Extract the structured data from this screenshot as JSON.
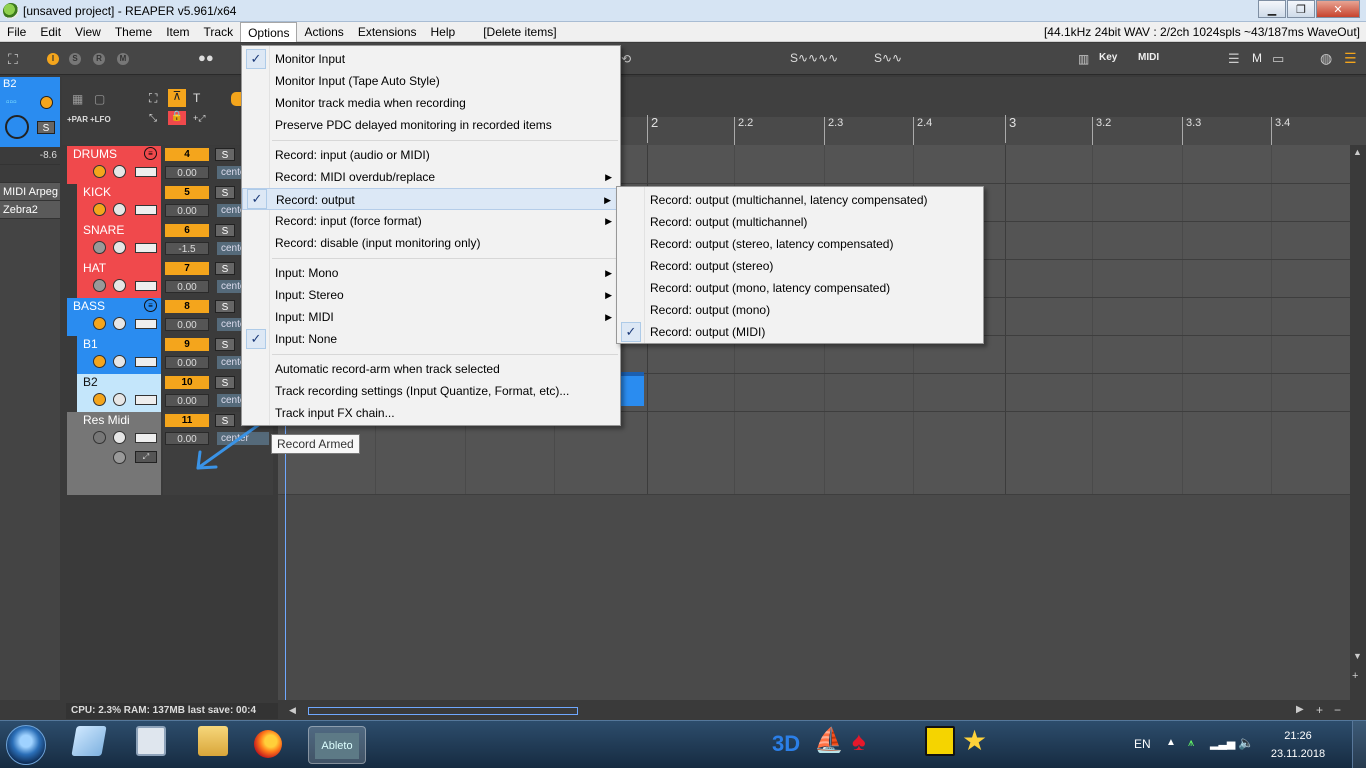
{
  "window": {
    "title": "[unsaved project] - REAPER v5.961/x64",
    "buttons": {
      "minimize": "▁",
      "maximize": "❐",
      "close": "✕"
    }
  },
  "menubar": {
    "items": [
      "File",
      "Edit",
      "View",
      "Theme",
      "Item",
      "Track",
      "Options",
      "Actions",
      "Extensions",
      "Help",
      "[Delete items]"
    ],
    "status": "[44.1kHz 24bit WAV : 2/2ch 1024spls ~43/187ms WaveOut]"
  },
  "toolbar": {
    "record_mode_letters": [
      "I",
      "S",
      "R",
      "M"
    ],
    "right_labels": {
      "key": "Key",
      "midi": "MIDI",
      "m": "M"
    },
    "fx_labels": {
      "par": "+PAR",
      "lfo": "+LFO",
      "t": "T"
    }
  },
  "left_panel": {
    "selected_track": "B2",
    "solo_label": "S",
    "meter_value": "-8.6",
    "fx_slots": [
      "MIDI Arpeg",
      "Zebra2"
    ]
  },
  "tracks": [
    {
      "name": "DRUMS",
      "number": "4",
      "volume": "0.00",
      "pan": "center",
      "solo": "S",
      "color": "#f0494c"
    },
    {
      "name": "KICK",
      "number": "5",
      "volume": "0.00",
      "pan": "center",
      "solo": "S",
      "color": "#f0494c"
    },
    {
      "name": "SNARE",
      "number": "6",
      "volume": "-1.5",
      "pan": "center",
      "solo": "S",
      "color": "#f0494c"
    },
    {
      "name": "HAT",
      "number": "7",
      "volume": "0.00",
      "pan": "center",
      "solo": "S",
      "color": "#f0494c"
    },
    {
      "name": "BASS",
      "number": "8",
      "volume": "0.00",
      "pan": "center",
      "solo": "S",
      "color": "#2a8cf0"
    },
    {
      "name": "B1",
      "number": "9",
      "volume": "0.00",
      "pan": "center",
      "solo": "S",
      "color": "#2a8cf0"
    },
    {
      "name": "B2",
      "number": "10",
      "volume": "0.00",
      "pan": "center",
      "solo": "S",
      "color": "#c4e6fb"
    },
    {
      "name": "Res Midi",
      "number": "11",
      "volume": "0.00",
      "pan": "center",
      "solo": "S",
      "color": "#767676"
    }
  ],
  "ruler": {
    "marks": [
      {
        "label": "2",
        "major": true
      },
      {
        "label": "2.2",
        "major": false
      },
      {
        "label": "2.3",
        "major": false
      },
      {
        "label": "2.4",
        "major": false
      },
      {
        "label": "3",
        "major": true
      },
      {
        "label": "3.2",
        "major": false
      },
      {
        "label": "3.3",
        "major": false
      },
      {
        "label": "3.4",
        "major": false
      }
    ]
  },
  "options_menu": {
    "items": [
      {
        "label": "Monitor Input",
        "checked": true,
        "submenu": false
      },
      {
        "label": "Monitor Input (Tape Auto Style)",
        "checked": false,
        "submenu": false
      },
      {
        "label": "Monitor track media when recording",
        "checked": false,
        "submenu": false
      },
      {
        "label": "Preserve PDC delayed monitoring in recorded items",
        "checked": false,
        "submenu": false
      },
      {
        "label": "Record: input (audio or MIDI)",
        "checked": false,
        "submenu": false
      },
      {
        "label": "Record: MIDI overdub/replace",
        "checked": false,
        "submenu": true
      },
      {
        "label": "Record: output",
        "checked": true,
        "submenu": true,
        "highlighted": true
      },
      {
        "label": "Record: input (force format)",
        "checked": false,
        "submenu": true
      },
      {
        "label": "Record: disable (input monitoring only)",
        "checked": false,
        "submenu": false
      },
      {
        "label": "Input: Mono",
        "checked": false,
        "submenu": true
      },
      {
        "label": "Input: Stereo",
        "checked": false,
        "submenu": true
      },
      {
        "label": "Input: MIDI",
        "checked": false,
        "submenu": true
      },
      {
        "label": "Input: None",
        "checked": true,
        "submenu": false
      },
      {
        "label": "Automatic record-arm when track selected",
        "checked": false,
        "submenu": false
      },
      {
        "label": "Track recording settings (Input Quantize, Format, etc)...",
        "checked": false,
        "submenu": false
      },
      {
        "label": "Track input FX chain...",
        "checked": false,
        "submenu": false
      }
    ]
  },
  "output_submenu": {
    "items": [
      {
        "label": "Record: output (multichannel, latency compensated)",
        "checked": false
      },
      {
        "label": "Record: output (multichannel)",
        "checked": false
      },
      {
        "label": "Record: output (stereo, latency compensated)",
        "checked": false
      },
      {
        "label": "Record: output (stereo)",
        "checked": false
      },
      {
        "label": "Record: output (mono, latency compensated)",
        "checked": false
      },
      {
        "label": "Record: output (mono)",
        "checked": false
      },
      {
        "label": "Record: output (MIDI)",
        "checked": true
      }
    ]
  },
  "tooltip": "Record Armed",
  "statusbar": "CPU: 2.3%  RAM: 137MB  last save: 00:4",
  "taskbar": {
    "lang": "EN",
    "time": "21:26",
    "date": "23.11.2018",
    "active_app_label": "Ableto",
    "label_3d": "3D"
  },
  "colors": {
    "accent": "#f4a51c",
    "blue": "#2a8cf0",
    "red": "#f0494c",
    "menu_highlight": "#dce8f6"
  }
}
